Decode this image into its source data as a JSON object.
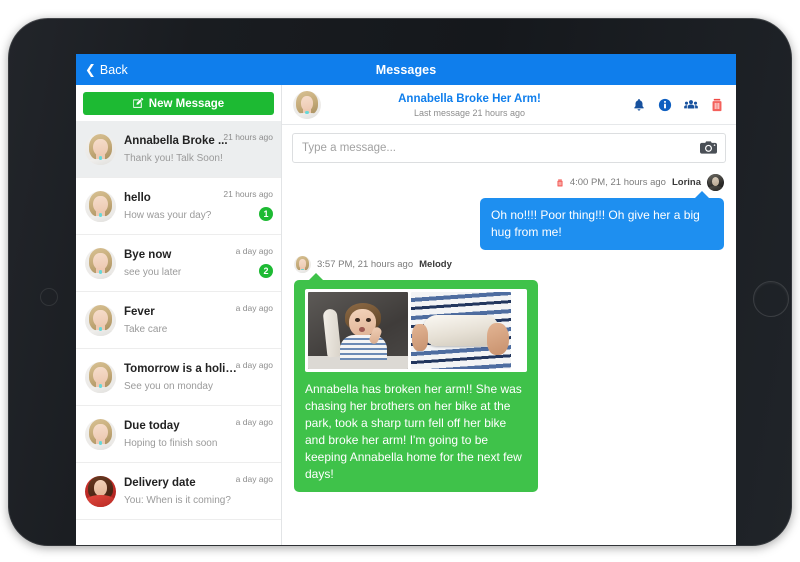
{
  "topbar": {
    "back_label": "Back",
    "title": "Messages",
    "accent_color": "#0f7eec"
  },
  "sidebar": {
    "new_message_label": "New Message",
    "new_message_color": "#1dba33",
    "conversations": [
      {
        "title": "Annabella Broke ...",
        "preview": "Thank you! Talk Soon!",
        "time": "21 hours ago",
        "badge": "",
        "avatar": "blonde",
        "active": true
      },
      {
        "title": "hello",
        "preview": "How was your day?",
        "time": "21 hours ago",
        "badge": "1",
        "avatar": "blonde",
        "active": false
      },
      {
        "title": "Bye now",
        "preview": "see you later",
        "time": "a day ago",
        "badge": "2",
        "avatar": "blonde",
        "active": false
      },
      {
        "title": "Fever",
        "preview": "Take care",
        "time": "a day ago",
        "badge": "",
        "avatar": "blonde",
        "active": false
      },
      {
        "title": "Tomorrow is a holiday",
        "preview": "See you on monday",
        "time": "a day ago",
        "badge": "",
        "avatar": "blonde",
        "active": false
      },
      {
        "title": "Due today",
        "preview": "Hoping to finish soon",
        "time": "a day ago",
        "badge": "",
        "avatar": "blonde",
        "active": false
      },
      {
        "title": "Delivery date",
        "preview": "You: When is it coming?",
        "time": "a day ago",
        "badge": "",
        "avatar": "red",
        "active": false
      }
    ]
  },
  "chat": {
    "title": "Annabella Broke Her Arm!",
    "subtitle": "Last message 21 hours ago",
    "title_color": "#0f7eec",
    "header_icons": [
      {
        "name": "bell-icon",
        "label": "Notifications"
      },
      {
        "name": "info-circle-icon",
        "label": "Conversation info"
      },
      {
        "name": "users-icon",
        "label": "Members"
      },
      {
        "name": "trash-icon",
        "label": "Delete conversation"
      }
    ],
    "composer": {
      "placeholder": "Type a message...",
      "value": "",
      "camera_label": "Attach photo"
    },
    "messages": [
      {
        "direction": "out",
        "time": "4:00 PM, 21 hours ago",
        "author": "Lorina",
        "avatar": "dark",
        "has_delete": true,
        "text": "Oh no!!!! Poor thing!!! Oh give her a big hug from me!",
        "bubble_color": "#1e8ff0",
        "media": []
      },
      {
        "direction": "in",
        "time": "3:57 PM, 21 hours ago",
        "author": "Melody",
        "avatar": "blonde",
        "has_delete": false,
        "text": "Annabella has broken her arm!! She was chasing her brothers on her bike at the park, took a sharp turn fell off her bike and broke her arm! I'm going to be keeping Annabella home for the next few days!",
        "bubble_color": "#3fc24a",
        "media": [
          {
            "name": "photo-girl-with-cast",
            "alt": "Girl pointing at her arm cast"
          },
          {
            "name": "photo-arm-cast-closeup",
            "alt": "Close-up of arm cast held in striped shirt"
          }
        ]
      }
    ]
  }
}
